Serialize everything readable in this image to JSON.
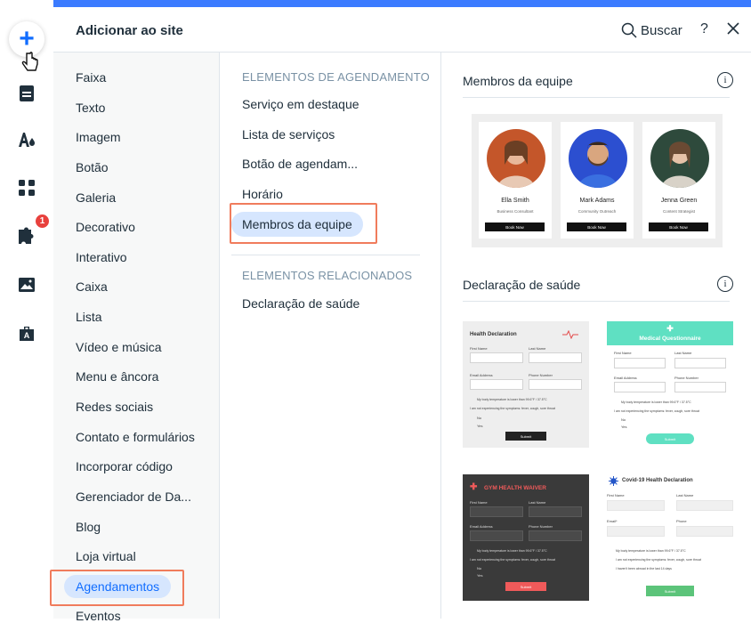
{
  "panel": {
    "title": "Adicionar ao site",
    "search_label": "Buscar",
    "help_label": "?"
  },
  "rail": {
    "badge_count": "1"
  },
  "categories": [
    "Faixa",
    "Texto",
    "Imagem",
    "Botão",
    "Galeria",
    "Decorativo",
    "Interativo",
    "Caixa",
    "Lista",
    "Vídeo e música",
    "Menu e âncora",
    "Redes sociais",
    "Contato e formulários",
    "Incorporar código",
    "Gerenciador de Da...",
    "Blog",
    "Loja virtual",
    "Agendamentos",
    "Eventos"
  ],
  "sub": {
    "section1": "ELEMENTOS DE AGENDAMENTO",
    "items1": [
      "Serviço em destaque",
      "Lista de serviços",
      "Botão de agendam...",
      "Horário",
      "Membros da equipe"
    ],
    "section2": "ELEMENTOS RELACIONADOS",
    "items2": [
      "Declaração de saúde"
    ]
  },
  "preview": {
    "team_title": "Membros da equipe",
    "health_title": "Declaração de saúde",
    "info_glyph": "i",
    "team": [
      {
        "name": "Ella Smith",
        "role": "Business Consultant",
        "button": "Book Now"
      },
      {
        "name": "Mark Adams",
        "role": "Community Outreach",
        "button": "Book Now"
      },
      {
        "name": "Jenna Green",
        "role": "Content Strategist",
        "button": "Book Now"
      }
    ],
    "form1": {
      "title": "Health Declaration",
      "first": "First Name",
      "last": "Last Name",
      "email": "Email Address",
      "phone": "Phone Number",
      "temp": "My body temperature is lower than 99.6°F / 37.5°C",
      "symptoms": "I am not experiencing the symptoms: fever, cough, sore throat",
      "no": "No",
      "yes": "Yes",
      "submit": "Submit"
    },
    "form2": {
      "title": "Medical Questionnaire",
      "first": "First Name",
      "last": "Last Name",
      "email": "Email Address",
      "phone": "Phone Number",
      "temp": "My body temperature is lower than 99.6°F / 37.5°C",
      "symptoms": "I am not experiencing the symptoms: fever, cough, sore throat",
      "no": "No",
      "yes": "Yes",
      "submit": "Submit"
    },
    "form3": {
      "title": "GYM HEALTH WAIVER",
      "first": "First Name",
      "last": "Last Name",
      "email": "Email Address",
      "phone": "Phone Number",
      "temp": "My body temperature is lower than 99.6°F / 37.5°C",
      "symptoms": "I am not experiencing the symptoms: fever, cough, sore throat",
      "no": "No",
      "yes": "Yes",
      "submit": "Submit"
    },
    "form4": {
      "title": "Covid-19 Health Declaration",
      "first": "First Name",
      "last": "Last Name",
      "email": "Email*",
      "phone": "Phone",
      "c1": "My body temperature is lower than 99.6°F / 37.5°C",
      "c2": "I am not experiencing the symptoms: fever, cough, sore throat",
      "c3": "I haven't been abroad in the last 14 days",
      "submit": "Submit"
    }
  },
  "colors": {
    "accent": "#116dff",
    "highlight": "#f07c5c",
    "active_bg": "#d6e6fe",
    "teal": "#5fe0c2",
    "gym_red": "#f05a5a",
    "gym_bg": "#3a3a3a"
  }
}
